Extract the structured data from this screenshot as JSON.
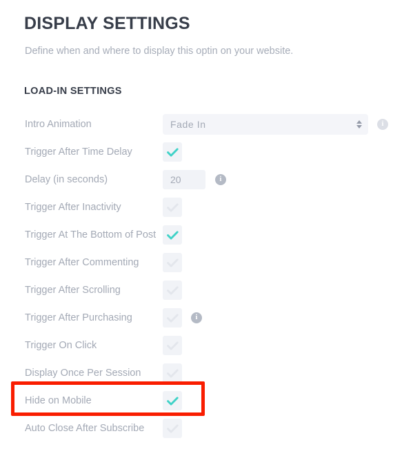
{
  "header": {
    "title": "DISPLAY SETTINGS",
    "subtitle": "Define when and where to display this optin on your website.",
    "section_title": "LOAD-IN SETTINGS"
  },
  "colors": {
    "title_text": "#373d49",
    "label_text": "#a3a9b5",
    "muted_text": "#a6acb8",
    "checkbox_bg": "#f1f3f7",
    "check_on": "#3fd2c7",
    "check_off": "#e3e6ec",
    "field_bg": "#f4f5f9",
    "highlight": "#f91d00",
    "info_strong": "#b4bac5",
    "info_faint": "#dcdfe6"
  },
  "icons": {
    "info": "info-icon",
    "check": "check-icon",
    "stepper": "select-stepper-icon"
  },
  "settings_rows": [
    {
      "id": "intro-animation",
      "label": "Intro Animation",
      "control": "select",
      "value": "Fade In",
      "options": [
        "Fade In"
      ],
      "info": "faint"
    },
    {
      "id": "trigger-after-time-delay",
      "label": "Trigger After Time Delay",
      "control": "checkbox",
      "checked": true,
      "info": null
    },
    {
      "id": "delay-in-seconds",
      "label": "Delay (in seconds)",
      "control": "text",
      "value": "20",
      "info": "strong"
    },
    {
      "id": "trigger-after-inactivity",
      "label": "Trigger After Inactivity",
      "control": "checkbox",
      "checked": false,
      "info": null
    },
    {
      "id": "trigger-at-the-bottom-of-post",
      "label": "Trigger At The Bottom of Post",
      "control": "checkbox",
      "checked": true,
      "info": null
    },
    {
      "id": "trigger-after-commenting",
      "label": "Trigger After Commenting",
      "control": "checkbox",
      "checked": false,
      "info": null
    },
    {
      "id": "trigger-after-scrolling",
      "label": "Trigger After Scrolling",
      "control": "checkbox",
      "checked": false,
      "info": null
    },
    {
      "id": "trigger-after-purchasing",
      "label": "Trigger After Purchasing",
      "control": "checkbox",
      "checked": false,
      "info": "strong"
    },
    {
      "id": "trigger-on-click",
      "label": "Trigger On Click",
      "control": "checkbox",
      "checked": false,
      "info": null
    },
    {
      "id": "display-once-per-session",
      "label": "Display Once Per Session",
      "control": "checkbox",
      "checked": false,
      "info": null
    },
    {
      "id": "hide-on-mobile",
      "label": "Hide on Mobile",
      "control": "checkbox",
      "checked": true,
      "info": null,
      "highlighted": true
    },
    {
      "id": "auto-close-after-subscribe",
      "label": "Auto Close After Subscribe",
      "control": "checkbox",
      "checked": false,
      "info": null
    }
  ]
}
